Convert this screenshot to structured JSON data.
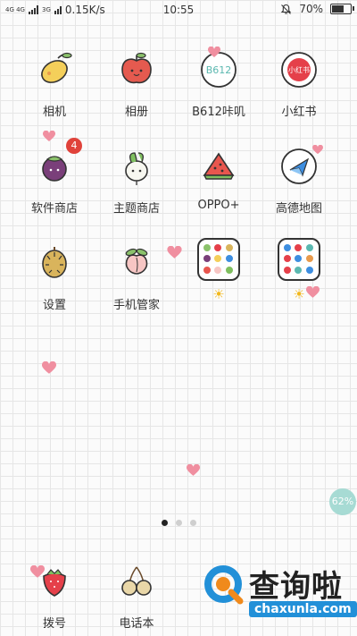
{
  "status_bar": {
    "network_left": "4G 4G",
    "network_mid": "3G",
    "speed": "0.15K/s",
    "time": "10:55",
    "battery_percent_text": "70%",
    "battery_level": 0.7
  },
  "apps": [
    {
      "label": "相机",
      "icon": "mango-icon"
    },
    {
      "label": "相册",
      "icon": "apple-icon"
    },
    {
      "label": "B612咔叽",
      "icon": "b612-icon"
    },
    {
      "label": "小红书",
      "icon": "xiaohongshu-icon"
    },
    {
      "label": "软件商店",
      "icon": "mangosteen-icon",
      "badge": "4"
    },
    {
      "label": "主题商店",
      "icon": "radish-icon"
    },
    {
      "label": "OPPO+",
      "icon": "watermelon-icon"
    },
    {
      "label": "高德地图",
      "icon": "map-icon"
    },
    {
      "label": "设置",
      "icon": "durian-icon"
    },
    {
      "label": "手机管家",
      "icon": "peach-icon"
    }
  ],
  "folders": [
    {
      "label": "☀",
      "icon": "folder-icon"
    },
    {
      "label": "☀",
      "icon": "folder-icon"
    }
  ],
  "icon_labels": {
    "b612": "B612",
    "xiaohongshu": "小红书"
  },
  "page_indicator": {
    "pages": 3,
    "current": 1
  },
  "float_ball": {
    "text": "62%"
  },
  "dock": [
    {
      "label": "拨号",
      "icon": "strawberry-icon"
    },
    {
      "label": "电话本",
      "icon": "cherry-icon"
    }
  ],
  "watermark": {
    "title": "查询啦",
    "url": "chaxunla.com"
  },
  "colors": {
    "heart": "#f08fa0",
    "badge": "#e0423a",
    "float_ball": "#9ed8d0",
    "watermark_blue": "#2290d8"
  }
}
